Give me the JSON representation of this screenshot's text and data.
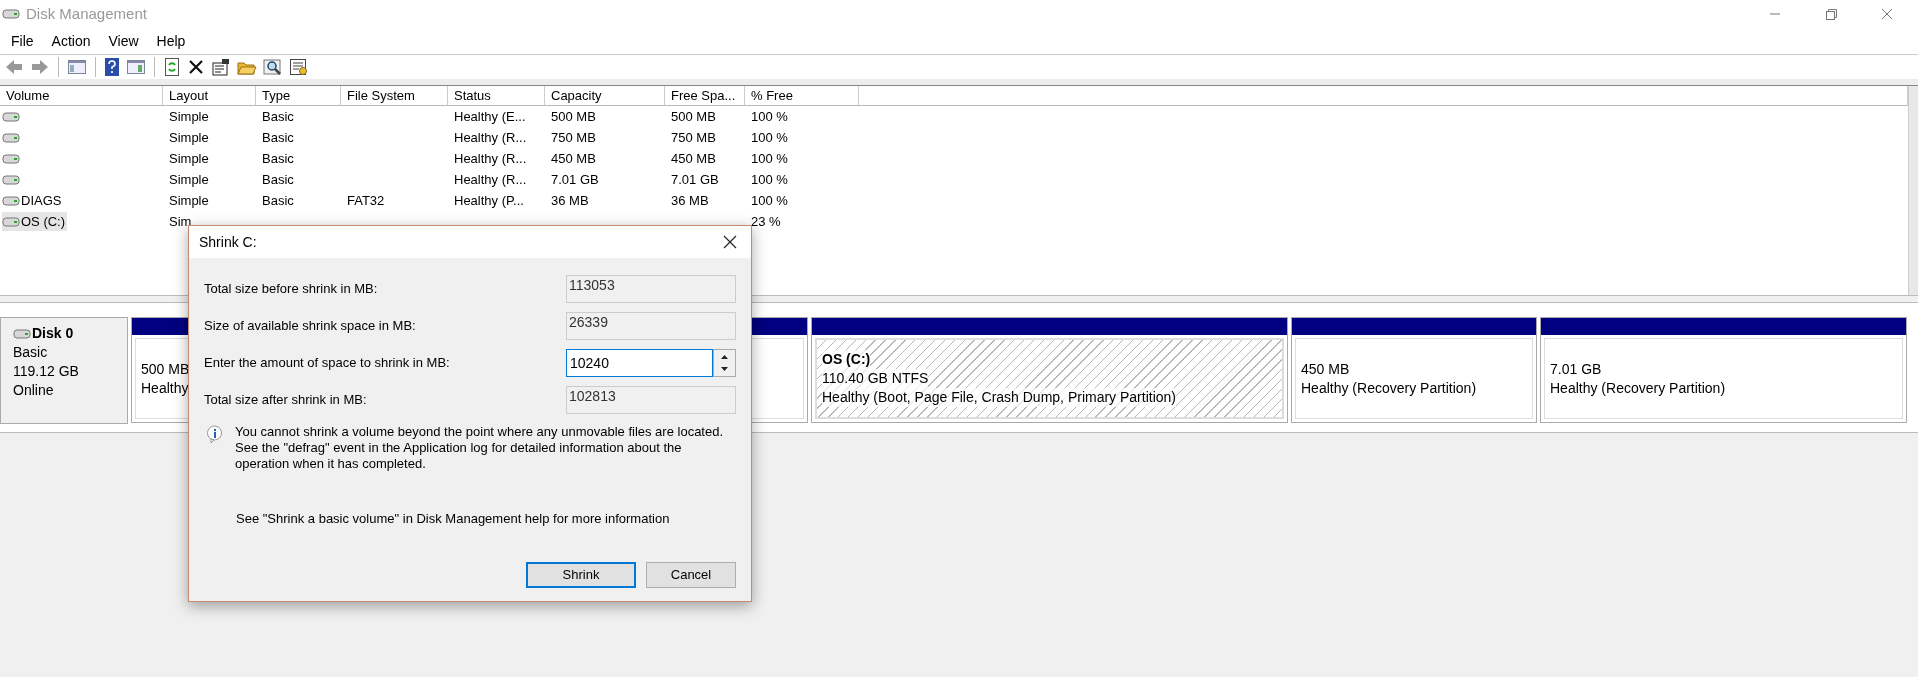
{
  "window": {
    "title": "Disk Management"
  },
  "menu": [
    "File",
    "Action",
    "View",
    "Help"
  ],
  "volume_table": {
    "columns": [
      "Volume",
      "Layout",
      "Type",
      "File System",
      "Status",
      "Capacity",
      "Free Spa...",
      "% Free"
    ],
    "rows": [
      {
        "cells": [
          null,
          "Simple",
          "Basic",
          null,
          "Healthy (E...",
          "500 MB",
          "500 MB",
          "100 %"
        ],
        "selected": false
      },
      {
        "cells": [
          null,
          "Simple",
          "Basic",
          null,
          "Healthy (R...",
          "750 MB",
          "750 MB",
          "100 %"
        ],
        "selected": false
      },
      {
        "cells": [
          null,
          "Simple",
          "Basic",
          null,
          "Healthy (R...",
          "450 MB",
          "450 MB",
          "100 %"
        ],
        "selected": false
      },
      {
        "cells": [
          null,
          "Simple",
          "Basic",
          null,
          "Healthy (R...",
          "7.01 GB",
          "7.01 GB",
          "100 %"
        ],
        "selected": false
      },
      {
        "cells": [
          "DIAGS",
          "Simple",
          "Basic",
          "FAT32",
          "Healthy (P...",
          "36 MB",
          "36 MB",
          "100 %"
        ],
        "selected": false
      },
      {
        "cells": [
          "OS (C:)",
          "Sim",
          null,
          null,
          null,
          null,
          null,
          "23 %"
        ],
        "selected": true
      }
    ]
  },
  "disks": [
    {
      "name": "Disk 0",
      "type": "Basic",
      "size": "119.12 GB",
      "status": "Online",
      "partitions": [
        {
          "size": "500 MB",
          "status": "Healthy",
          "selected": false
        },
        {
          "name": "OS  (C:)",
          "size": "110.40 GB NTFS",
          "status": "Healthy (Boot, Page File, Crash Dump, Primary Partition)",
          "selected": true
        },
        {
          "size": "450 MB",
          "status": "Healthy (Recovery Partition)",
          "selected": false
        },
        {
          "size": "7.01 GB",
          "status": "Healthy (Recovery Partition)",
          "selected": false
        }
      ]
    }
  ],
  "dialog": {
    "title": "Shrink C:",
    "fields": [
      {
        "label": "Total size before shrink in MB:",
        "value": "113053",
        "kind": "readonly"
      },
      {
        "label": "Size of available shrink space in MB:",
        "value": "26339",
        "kind": "readonly"
      },
      {
        "label": "Enter the amount of space to shrink in MB:",
        "value": "10240",
        "kind": "spin"
      },
      {
        "label": "Total size after shrink in MB:",
        "value": "102813",
        "kind": "readonly"
      }
    ],
    "info": "You cannot shrink a volume beyond the point where any unmovable files are located. See the \"defrag\" event in the Application log for detailed information about the operation when it has completed.",
    "help": "See \"Shrink a basic volume\" in Disk Management help for more information",
    "buttons": [
      {
        "label": "Shrink",
        "default": true
      },
      {
        "label": "Cancel",
        "default": false
      }
    ]
  }
}
